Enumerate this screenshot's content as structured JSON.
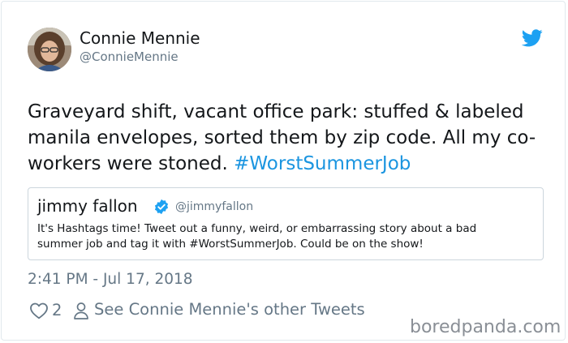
{
  "author": {
    "name": "Connie Mennie",
    "handle": "@ConnieMennie"
  },
  "tweet": {
    "text": "Graveyard shift, vacant office park: stuffed & labeled manila envelopes, sorted them by zip code. All my co-workers were stoned. ",
    "hashtag": "#WorstSummerJob",
    "timestamp": "2:41 PM - Jul 17, 2018",
    "likes": "2",
    "other_tweets_label": "See Connie Mennie's other Tweets"
  },
  "quoted_tweet": {
    "name": "jimmy fallon",
    "handle": "@jimmyfallon",
    "text": "It's Hashtags time! Tweet out a funny, weird, or embarrassing story about a bad summer job and tag it with #WorstSummerJob. Could be on the show!"
  },
  "icons": {
    "brand": "twitter-bird-icon",
    "verified": "verified-badge-icon",
    "like": "heart-icon",
    "profile": "person-icon"
  },
  "colors": {
    "twitter_blue": "#1da1f2",
    "link_blue": "#1b95e0",
    "muted_gray": "#657786",
    "text_dark": "#14171a"
  },
  "watermark": "boredpanda.com"
}
